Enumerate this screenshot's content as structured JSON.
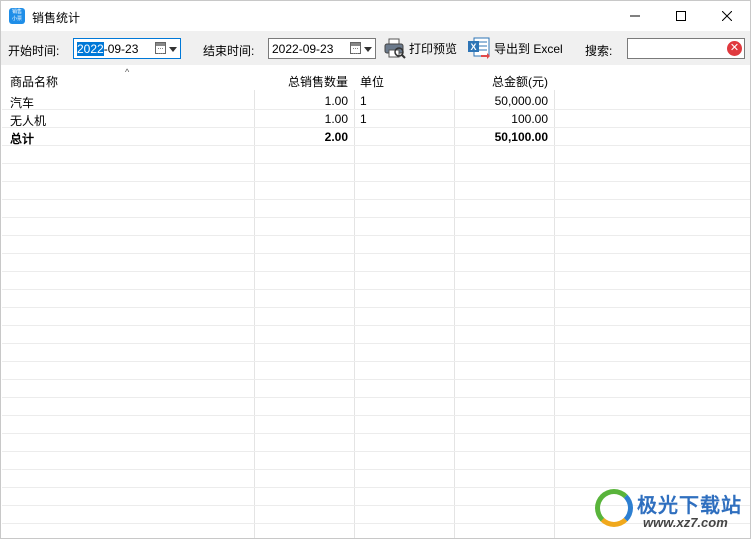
{
  "window": {
    "title": "销售统计",
    "app_icon_text": "销售\n小票",
    "controls": {
      "minimize": "minimize-icon",
      "maximize": "maximize-icon",
      "close": "close-icon"
    }
  },
  "toolbar": {
    "start_label": "开始时间:",
    "start_date_selected": "2022",
    "start_date_rest": "-09-23",
    "end_label": "结束时间:",
    "end_date": "2022-09-23",
    "print_preview_label": "打印预览",
    "export_label": "导出到 Excel",
    "search_label": "搜索:",
    "search_value": ""
  },
  "table": {
    "columns": [
      "商品名称",
      "总销售数量",
      "单位",
      "总金额(元)"
    ],
    "rows": [
      {
        "name": "汽车",
        "qty": "1.00",
        "unit": "1",
        "amount": "50,000.00"
      },
      {
        "name": "无人机",
        "qty": "1.00",
        "unit": "1",
        "amount": "100.00"
      }
    ],
    "total": {
      "name": "总计",
      "qty": "2.00",
      "unit": "",
      "amount": "50,100.00"
    }
  },
  "watermark": {
    "title": "极光下载站",
    "url": "www.xz7.com"
  },
  "colors": {
    "toolbar_bg": "#f0f0f0",
    "selection": "#0078d7",
    "clear_button": "#e0393e",
    "app_icon": "#1f8ee8"
  }
}
